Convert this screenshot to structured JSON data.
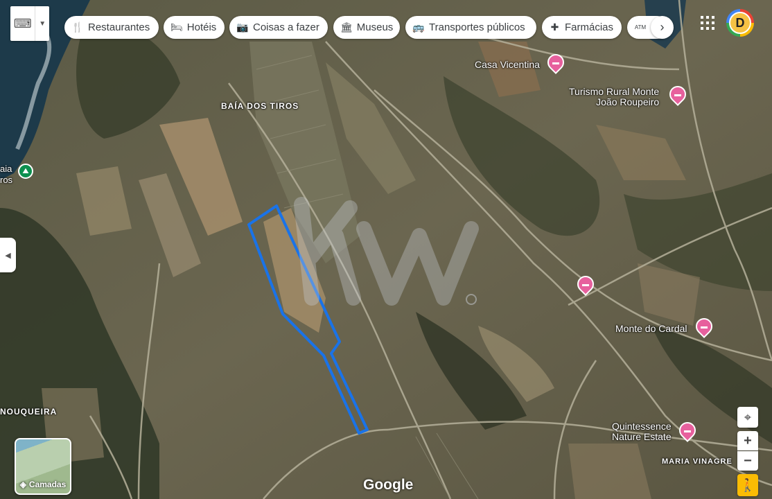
{
  "toolbar": {
    "chips": [
      {
        "label": "Restaurantes",
        "icon": "cutlery-icon",
        "glyph": "🍴"
      },
      {
        "label": "Hotéis",
        "icon": "bed-icon",
        "glyph": "🛏"
      },
      {
        "label": "Coisas a fazer",
        "icon": "camera-icon",
        "glyph": "📷"
      },
      {
        "label": "Museus",
        "icon": "museum-icon",
        "glyph": "🏛"
      },
      {
        "label": "Transportes públicos",
        "icon": "bus-icon",
        "glyph": "🚌"
      },
      {
        "label": "Farmácias",
        "icon": "pharmacy-icon",
        "glyph": "✚"
      },
      {
        "label": "ATM M",
        "icon": "atm-icon",
        "glyph": "ATM"
      }
    ]
  },
  "avatar": {
    "initial": "D"
  },
  "layers": {
    "label": "Camadas"
  },
  "map_labels": {
    "baia_dos_tiros": "BAÍA DOS TIROS",
    "baia_tiros_left": "aia\nros",
    "nouqueira": "NOUQUEIRA",
    "maria_vinagre": "MARIA VINAGRE",
    "casa_vicentina": "Casa Vicentina",
    "turismo_rural": "Turismo Rural Monte\nJoão Roupeiro",
    "monte_do_cardal": "Monte do Cardal",
    "quintessence": "Quintessence\nNature Estate"
  },
  "attribution": "Google",
  "watermark": "KW",
  "colors": {
    "parcel_outline": "#1a73e8",
    "hotel_pin": "#e7609d",
    "park_pin": "#0d904f"
  }
}
